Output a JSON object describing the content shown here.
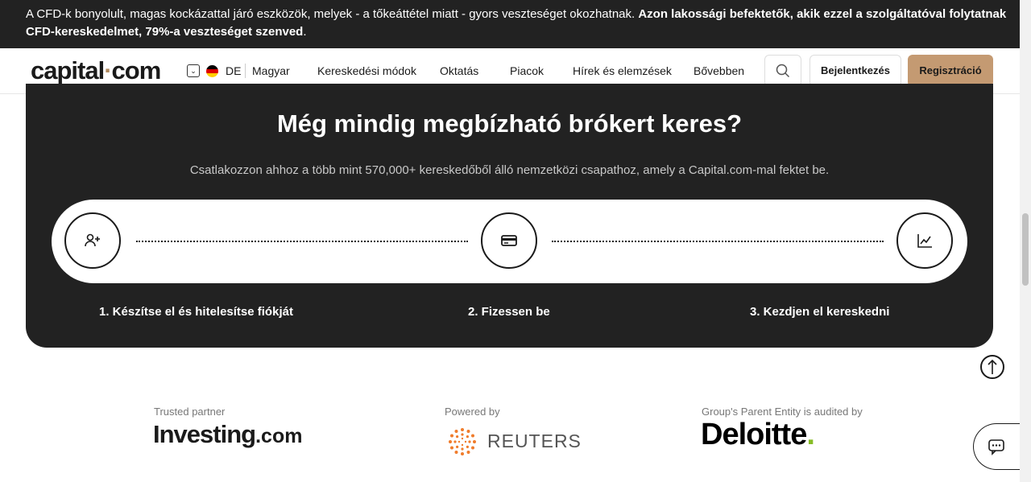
{
  "risk_banner": {
    "text": "A CFD-k bonyolult, magas kockázattal járó eszközök, melyek - a tőkeáttétel miatt - gyors veszteséget okozhatnak. ",
    "bold_text": "Azon lakossági befektetők, akik ezzel a szolgáltatóval folytatnak CFD-kereskedelmet, 79%-a veszteséget szenved",
    "suffix": "."
  },
  "nav": {
    "logo_left": "capital",
    "logo_dot": "·",
    "logo_right": "com",
    "lang_toggle": "⌄",
    "lang_code": "DE",
    "lang_name": "Magyar",
    "items": [
      "Kereskedési módok",
      "Oktatás",
      "Piacok",
      "Hírek és elemzések",
      "Bővebben"
    ],
    "login_label": "Bejelentkezés",
    "register_label": "Regisztráció"
  },
  "cta": {
    "title": "Még mindig megbízható brókert keres?",
    "subtitle": "Csatlakozzon ahhoz a több mint 570,000+ kereskedőből álló nemzetközi csapathoz, amely a Capital.com-mal fektet be.",
    "steps": [
      {
        "label": "1. Készítse el és hitelesítse fiókját",
        "icon": "add-user-icon"
      },
      {
        "label": "2. Fizessen be",
        "icon": "credit-card-icon"
      },
      {
        "label": "3. Kezdjen el kereskedni",
        "icon": "chart-line-icon"
      }
    ]
  },
  "partners": {
    "investing_caption": "Trusted partner",
    "investing_name": "Investing",
    "investing_suffix": ".com",
    "reuters_caption": "Powered by",
    "reuters_name": "REUTERS",
    "deloitte_caption": "Group's Parent Entity is audited by",
    "deloitte_name": "Deloitte",
    "deloitte_dot": "."
  },
  "colors": {
    "dark_panel": "#222222",
    "accent": "#c49a72",
    "deloitte_green": "#86bc25"
  }
}
